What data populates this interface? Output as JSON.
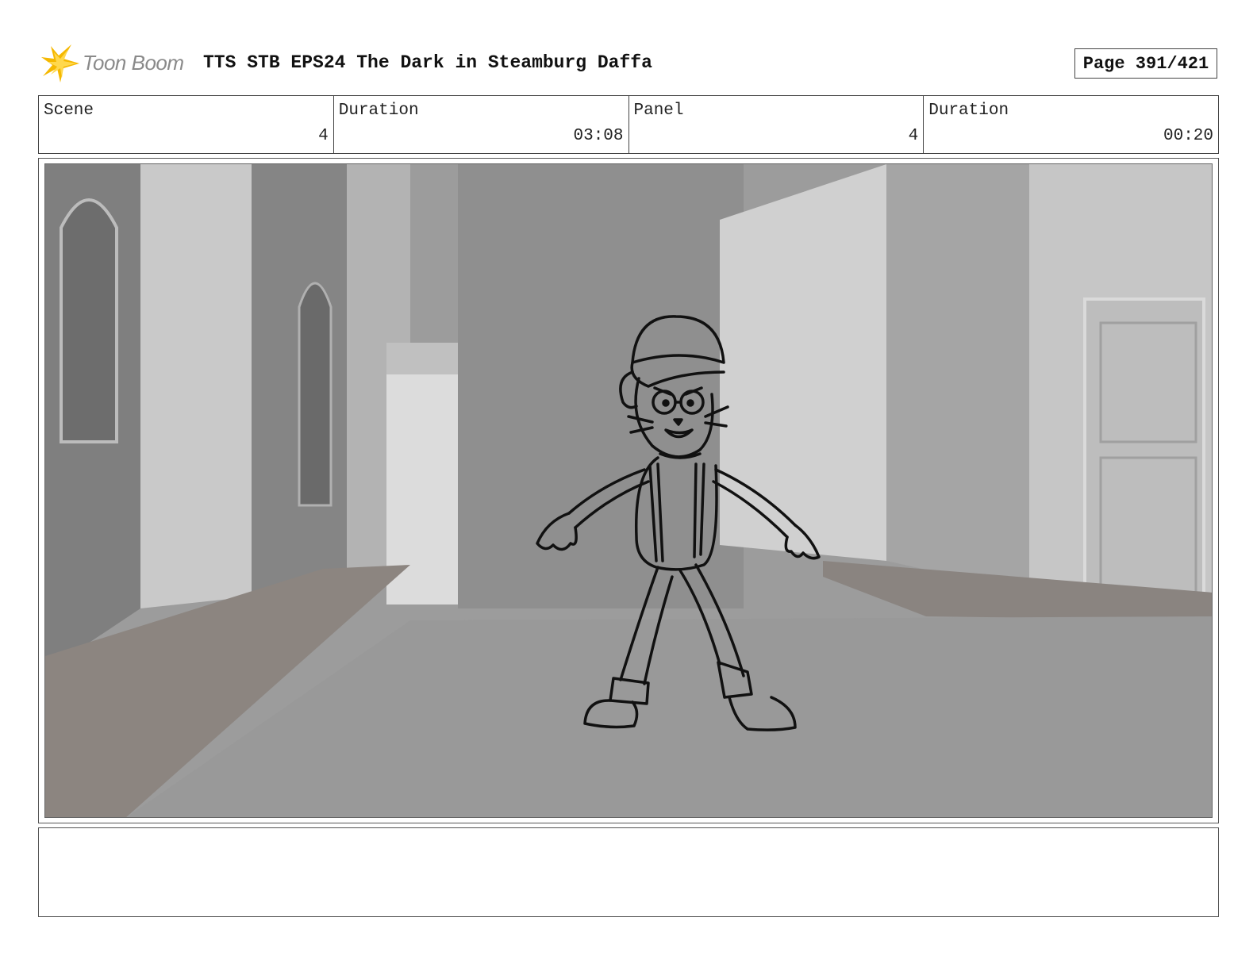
{
  "header": {
    "logo_text": "Toon Boom",
    "title": "TTS STB EPS24 The Dark in Steamburg Daffa",
    "page": "Page 391/421"
  },
  "info": [
    {
      "label": "Scene",
      "value": "4"
    },
    {
      "label": "Duration",
      "value": "03:08"
    },
    {
      "label": "Panel",
      "value": "4"
    },
    {
      "label": "Duration",
      "value": "00:20"
    }
  ],
  "panel": {
    "image_icon": "storyboard-sketch-icon"
  },
  "notes": {
    "text": ""
  },
  "colors": {
    "logo_accent": "#f5b800",
    "logo_text": "#8a8a8a",
    "border": "#444444"
  }
}
